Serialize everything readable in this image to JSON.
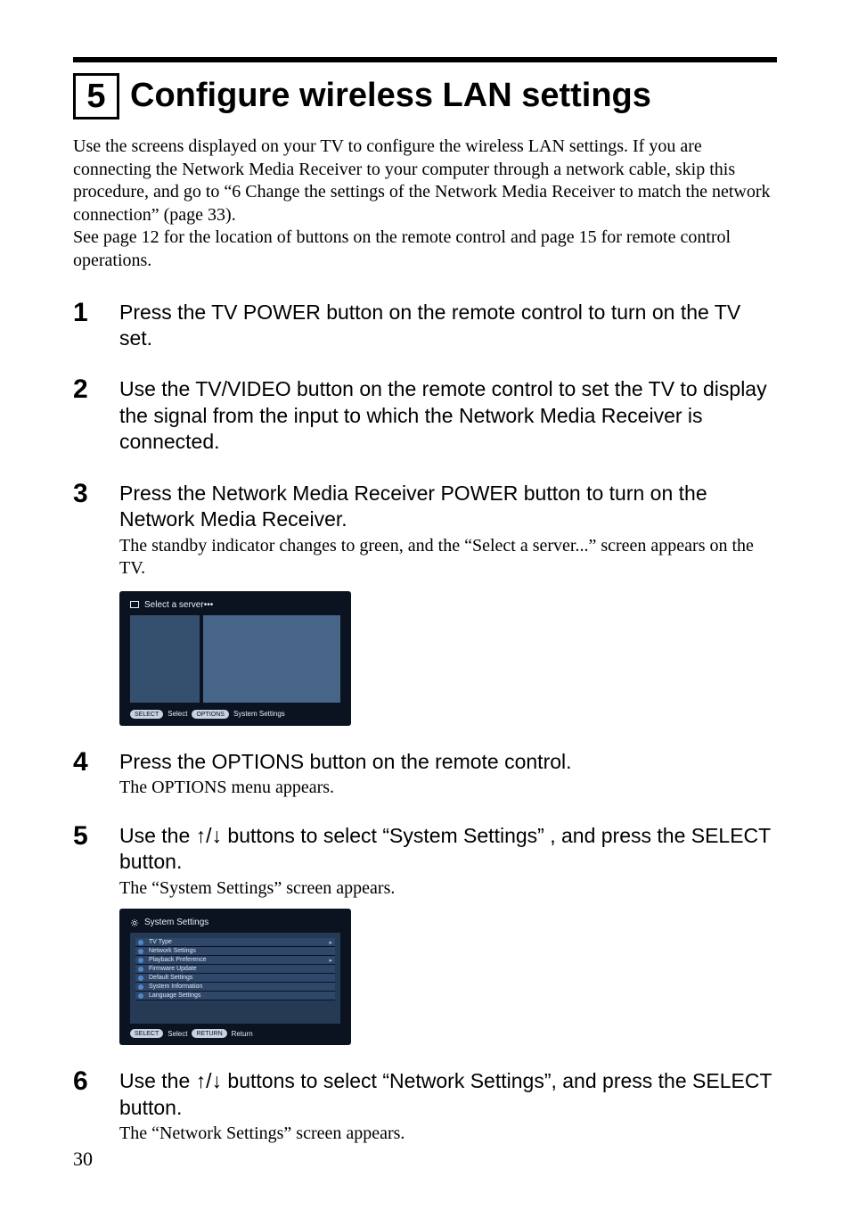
{
  "rule": true,
  "step_box": "5",
  "title": "Configure wireless LAN settings",
  "intro_p1": "Use the screens displayed on your TV to configure the wireless LAN settings. If you are connecting the Network Media Receiver to your computer through a network cable, skip this procedure, and go to “6 Change the settings of the Network Media Receiver to match the network connection” (page 33).",
  "intro_p2": "See page 12 for the location of buttons on the remote control and page 15 for remote control operations.",
  "steps": [
    {
      "num": "1",
      "heading": "Press the TV POWER button on the remote control to turn on the TV set."
    },
    {
      "num": "2",
      "heading": "Use the TV/VIDEO button on the remote control to set the TV to display the signal from the input to which the Network Media Receiver is connected."
    },
    {
      "num": "3",
      "heading": "Press the Network Media Receiver POWER button to turn on the Network Media Receiver.",
      "detail": "The standby indicator changes to green, and the “Select a server...” screen appears on the TV."
    },
    {
      "num": "4",
      "heading": "Press the OPTIONS button on the remote control.",
      "detail": "The OPTIONS menu appears."
    },
    {
      "num": "5",
      "heading_pre": "Use the ",
      "heading_post": " buttons to select “System Settings” , and press the SELECT button.",
      "arrows": "↑/↓",
      "detail": "The “System Settings” screen appears."
    },
    {
      "num": "6",
      "heading_pre": "Use the ",
      "heading_post": " buttons to select “Network Settings”, and press the SELECT button.",
      "arrows": "↑/↓",
      "detail": "The “Network Settings” screen appears."
    }
  ],
  "shot1": {
    "header": "Select a server•••",
    "footer_select_pill": "SELECT",
    "footer_select_label": "Select",
    "footer_options_pill": "OPTIONS",
    "footer_options_label": "System Settings"
  },
  "shot2": {
    "header": "System Settings",
    "items": [
      {
        "label": "TV Type",
        "chev": "▸"
      },
      {
        "label": "Network Settings",
        "chev": ""
      },
      {
        "label": "Playback Preference",
        "chev": "▸"
      },
      {
        "label": "Firmware Update",
        "chev": ""
      },
      {
        "label": "Default Settings",
        "chev": ""
      },
      {
        "label": "System Information",
        "chev": ""
      },
      {
        "label": "Language Settings",
        "chev": ""
      }
    ],
    "footer_select_pill": "SELECT",
    "footer_select_label": "Select",
    "footer_return_pill": "RETURN",
    "footer_return_label": "Return"
  },
  "page_number": "30"
}
